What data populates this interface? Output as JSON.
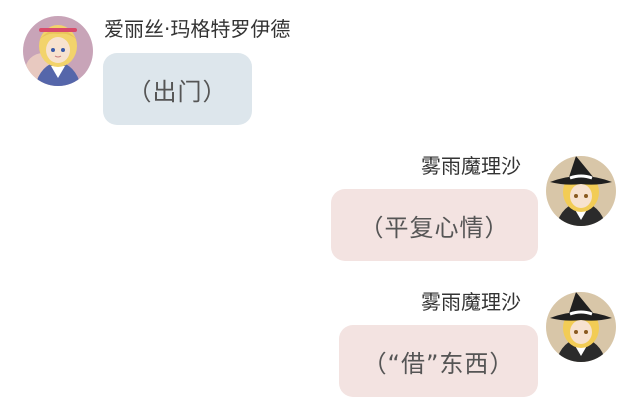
{
  "messages": [
    {
      "side": "left",
      "sender": "爱丽丝·玛格特罗伊德",
      "text": "（出门）",
      "avatar_icon": "alice-avatar-icon"
    },
    {
      "side": "right",
      "sender": "雾雨魔理沙",
      "text": "（平复心情）",
      "avatar_icon": "marisa-avatar-icon"
    },
    {
      "side": "right",
      "sender": "雾雨魔理沙",
      "text": "（“借”东西）",
      "avatar_icon": "marisa-avatar-icon"
    }
  ],
  "colors": {
    "left_bubble": "#dde6ec",
    "right_bubble": "#f3e3e1",
    "name_text": "#333333",
    "bubble_text": "#555555"
  }
}
